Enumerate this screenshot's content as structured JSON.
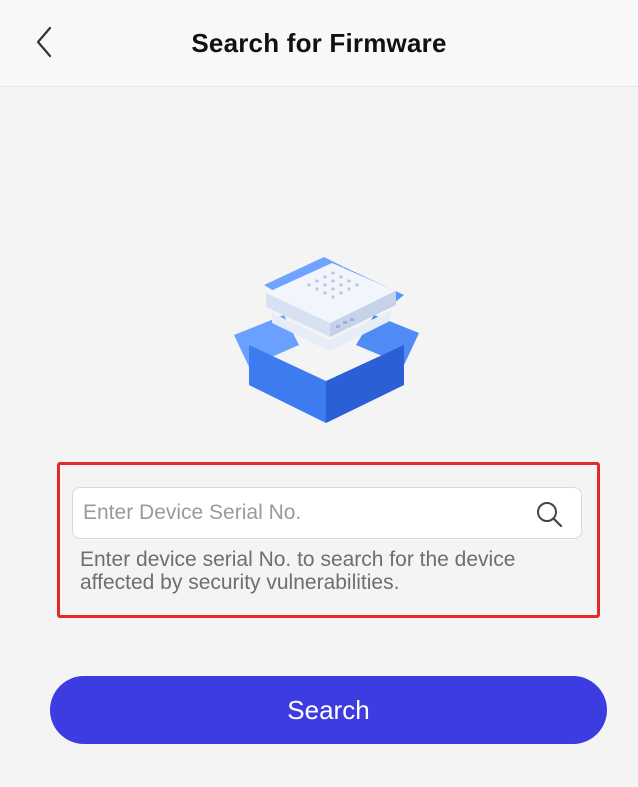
{
  "header": {
    "title": "Search for Firmware",
    "back_icon": "chevron-left-icon"
  },
  "illustration": {
    "icon": "firmware-box-icon",
    "colors": {
      "box_blue": "#3d7cf0",
      "box_dark": "#2a5fd6",
      "box_light": "#6fa3ff",
      "device": "#f2f5fb"
    }
  },
  "search": {
    "placeholder": "Enter Device Serial No.",
    "value": "",
    "icon": "search-icon",
    "hint": "Enter device serial No. to search for the device affected by security vulnerabilities.",
    "highlight_color": "#e32a2a"
  },
  "actions": {
    "search_label": "Search",
    "button_color": "#3d3ce0"
  }
}
